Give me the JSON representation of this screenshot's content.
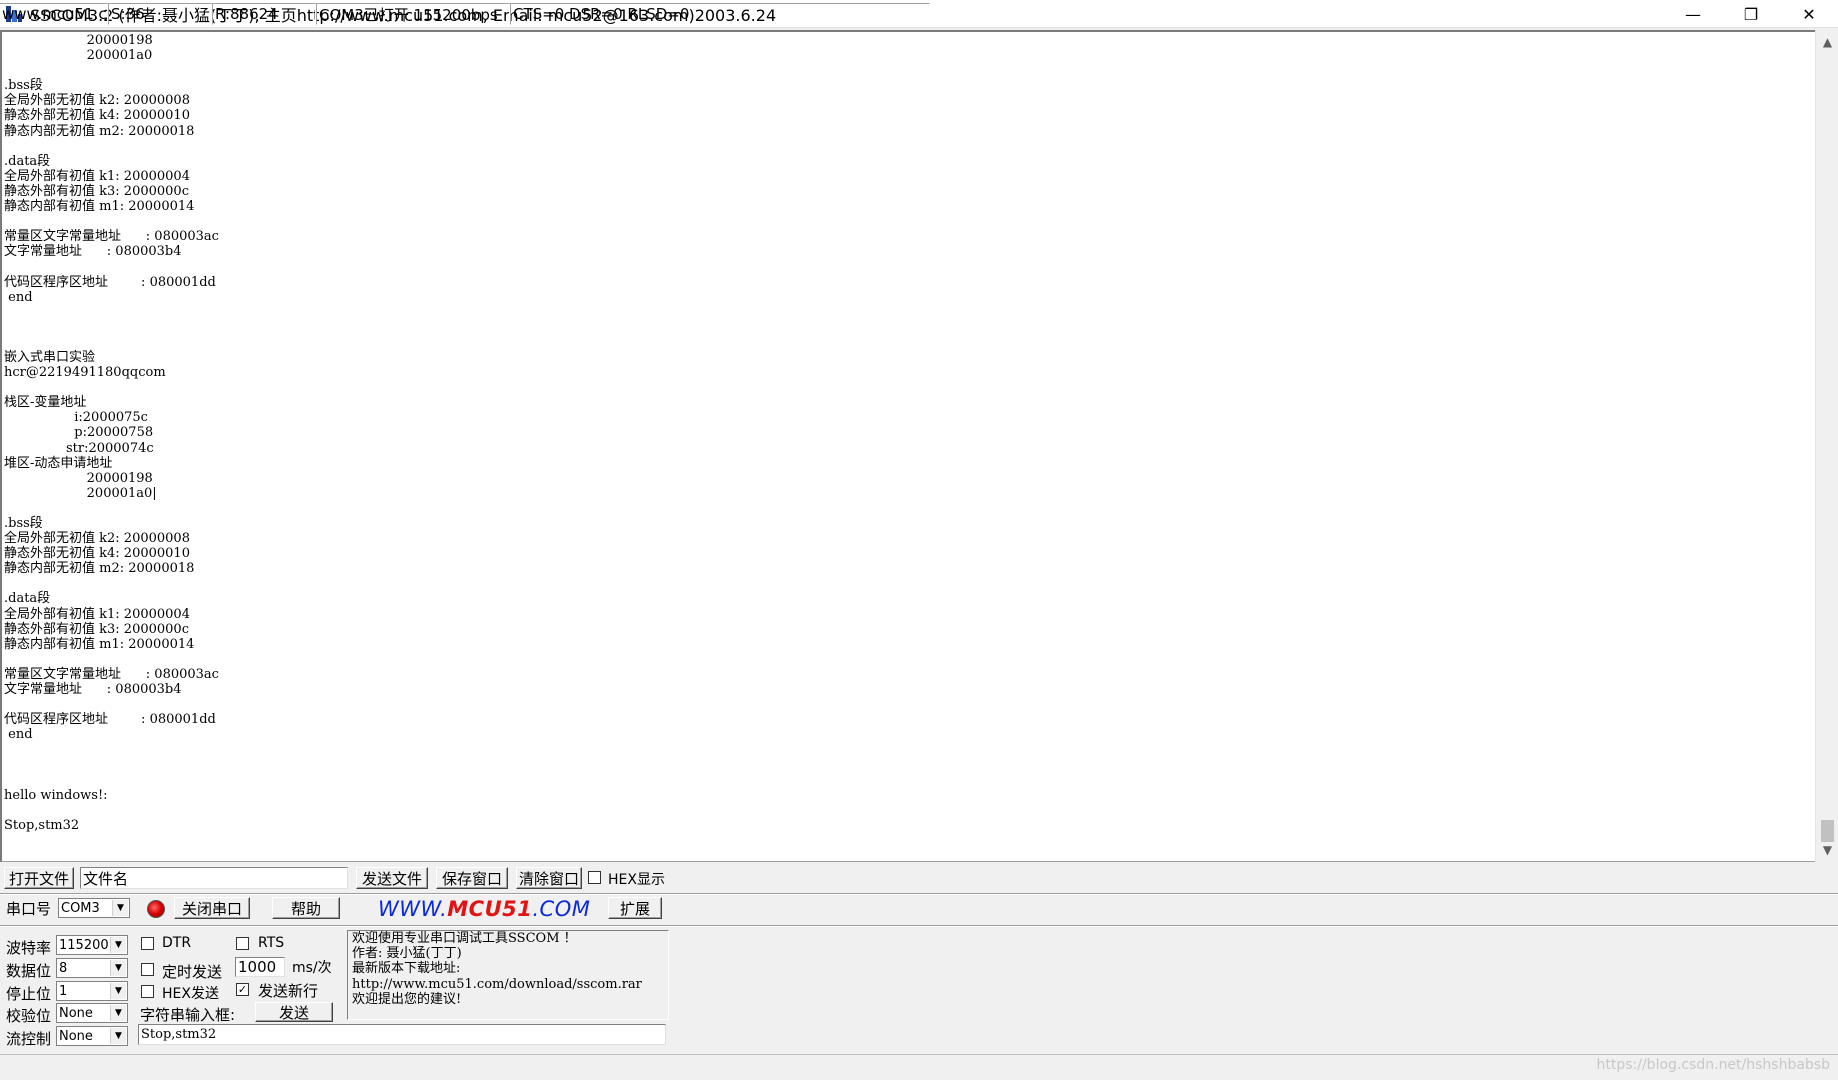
{
  "window": {
    "title": "SSCOM3.2 (作者:聂小猛(丁丁), 主页http://www.mcu51.com,  Email: mcu52@163.com)2003.6.24",
    "minimize": "—",
    "maximize": "❐",
    "close": "✕"
  },
  "output": {
    "text": "                    20000198\n                    200001a0\n\n.bss段\n全局外部无初值 k2: 20000008\n静态外部无初值 k4: 20000010\n静态内部无初值 m2: 20000018\n\n.data段\n全局外部有初值 k1: 20000004\n静态外部有初值 k3: 2000000c\n静态内部有初值 m1: 20000014\n\n常量区文字常量地址      : 080003ac\n文字常量地址      : 080003b4\n\n代码区程序区地址        : 080001dd\n end\n\n\n\n嵌入式串口实验\nhcr@2219491180qqcom\n\n栈区-变量地址\n                 i:2000075c\n                 p:20000758\n               str:2000074c\n堆区-动态申请地址\n                    20000198\n                    200001a0|\n\n.bss段\n全局外部无初值 k2: 20000008\n静态外部无初值 k4: 20000010\n静态内部无初值 m2: 20000018\n\n.data段\n全局外部有初值 k1: 20000004\n静态外部有初值 k3: 2000000c\n静态内部有初值 m1: 20000014\n\n常量区文字常量地址      : 080003ac\n文字常量地址      : 080003b4\n\n代码区程序区地址        : 080001dd\n end\n\n\n\nhello windows!:\n\nStop,stm32"
  },
  "toolbar1": {
    "open_file": "打开文件",
    "file_name": "文件名",
    "send_file": "发送文件",
    "save_window": "保存窗口",
    "clear_window": "清除窗口",
    "hex_display": "HEX显示",
    "hex_display_checked": false
  },
  "toolbar2": {
    "port_label": "串口号",
    "port_value": "COM3",
    "close_port": "关闭串口",
    "help": "帮助",
    "link_prefix": "WWW.",
    "link_brand": "MCU51",
    "link_suffix": ".COM",
    "expand": "扩展"
  },
  "settings": {
    "baud_label": "波特率",
    "baud_value": "115200",
    "databits_label": "数据位",
    "databits_value": "8",
    "stopbits_label": "停止位",
    "stopbits_value": "1",
    "parity_label": "校验位",
    "parity_value": "None",
    "flow_label": "流控制",
    "flow_value": "None"
  },
  "options": {
    "dtr": "DTR",
    "dtr_checked": false,
    "rts": "RTS",
    "rts_checked": false,
    "timed_send": "定时发送",
    "timed_send_checked": false,
    "interval": "1000",
    "interval_unit": "ms/次",
    "hex_send": "HEX发送",
    "hex_send_checked": false,
    "send_newline": "发送新行",
    "send_newline_checked": true,
    "input_label": "字符串输入框:",
    "send_button": "发送",
    "send_text": "Stop,stm32"
  },
  "info": {
    "lines": [
      "欢迎使用专业串口调试工具SSCOM ！",
      "作者: 聂小猛(丁丁)",
      "最新版本下载地址:",
      "http://www.mcu51.com/download/sscom.rar",
      "欢迎提出您的建议!"
    ]
  },
  "status": {
    "site": "www.mcu51.cor",
    "sent": "S:36",
    "received": "R:88624",
    "port_state": "COM3已打开  115200bps",
    "signals": "CTS=0 DSR=0 RLSD=0"
  },
  "watermark": "https://blog.csdn.net/hshshbabsb"
}
